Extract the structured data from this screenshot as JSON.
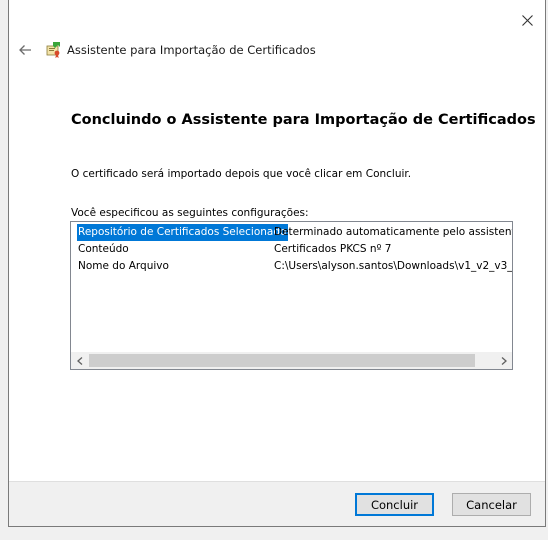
{
  "window": {
    "title": "Assistente para Importação de Certificados",
    "icons": {
      "close": "close-icon",
      "back": "back-arrow-icon",
      "wizard": "certificate-wizard-icon"
    }
  },
  "content": {
    "heading": "Concluindo o Assistente para Importação de Certificados",
    "message": "O certificado será importado depois que você clicar em Concluir.",
    "settings_label": "Você especificou as seguintes configurações:",
    "settings": [
      {
        "key": "Repositório de Certificados Selecionado",
        "value": "Determinado automaticamente pelo assistente",
        "selected": true
      },
      {
        "key": "Conteúdo",
        "value": "Certificados PKCS nº 7",
        "selected": false
      },
      {
        "key": "Nome do Arquivo",
        "value": "C:\\Users\\alyson.santos\\Downloads\\v1_v2_v3_",
        "selected": false
      }
    ]
  },
  "buttons": {
    "finish": "Concluir",
    "cancel": "Cancelar"
  },
  "colors": {
    "selection": "#0078d7",
    "primary_border": "#0078d7"
  }
}
